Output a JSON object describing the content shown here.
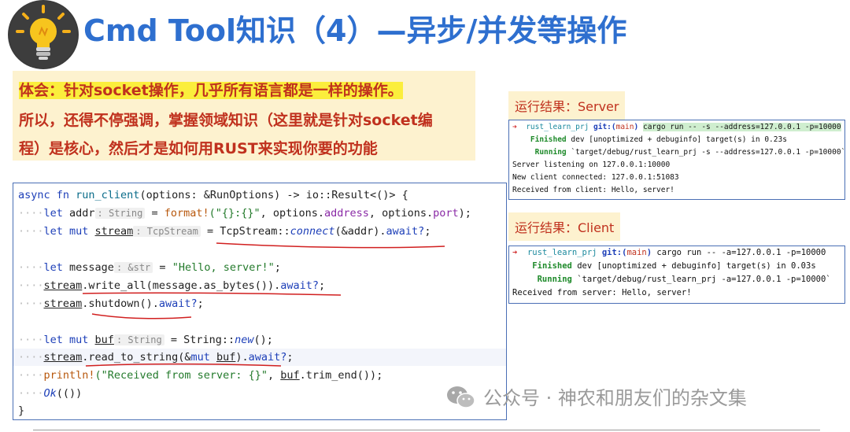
{
  "title": "Cmd Tool知识（4）—异步/并发等操作",
  "note": {
    "line1": "体会：针对socket操作，几乎所有语言都是一样的操作。",
    "line2": "所以，还得不停强调，掌握领域知识（这里就是针对socket编",
    "line3": "程）是核心，然后才是如何用RUST来实现你要的功能"
  },
  "code": {
    "l1": {
      "a": "async fn ",
      "b": "run_client",
      "c": "(options: &RunOptions) -> io::Result<()> {"
    },
    "l2": {
      "a": "let ",
      "b": "addr",
      "hint": ": String",
      "c": " = ",
      "d": "format!",
      "e": "(\"{}:{}\"",
      "f": ", options.",
      "g": "address",
      "h": ", options.",
      "i": "port",
      "j": ");"
    },
    "l3": {
      "a": "let mut ",
      "b": "stream",
      "hint": ": TcpStream",
      "c": " = TcpStream::",
      "d": "connect",
      "e": "(&addr).",
      "f": "await?",
      "g": ";"
    },
    "l5": {
      "a": "let ",
      "b": "message",
      "hint": ": &str",
      "c": " = ",
      "d": "\"Hello, server!\"",
      "e": ";"
    },
    "l6": {
      "a": "stream",
      "b": ".write_all(message.as_bytes()).",
      "c": "await?",
      "d": ";"
    },
    "l7": {
      "a": "stream",
      "b": ".shutdown().",
      "c": "await?",
      "d": ";"
    },
    "l9": {
      "a": "let mut ",
      "b": "buf",
      "hint": ": String",
      "c": " = String::",
      "d": "new",
      "e": "();"
    },
    "l10": {
      "a": "stream",
      "b": ".read_to_string(&",
      "c": "mut ",
      "d": "buf",
      "e": ").",
      "f": "await?",
      "g": ";"
    },
    "l11": {
      "a": "println!",
      "b": "(\"Received from server: {}\"",
      "c": ", ",
      "d": "buf",
      "e": ".trim_end());"
    },
    "l12": {
      "a": "Ok",
      "b": "(())"
    },
    "l13": "}"
  },
  "server": {
    "label": "运行结果：Server",
    "lines": {
      "l1_arrow": "➜",
      "l1_prj": "rust_learn_prj",
      "l1_git": "git:(",
      "l1_branch": "main",
      "l1_git_close": ")",
      "l1_cmd": "cargo run -- -s --address=127.0.0.1 -p=10000",
      "l2_kw": "Finished",
      "l2_rest": "dev [unoptimized + debuginfo] target(s) in 0.23s",
      "l3_kw": "Running",
      "l3_rest": "`target/debug/rust_learn_prj -s --address=127.0.0.1 -p=10000`",
      "l4": "Server listening on 127.0.0.1:10000",
      "l5": "New client connected: 127.0.0.1:51083",
      "l6": "Received from client: Hello, server!"
    }
  },
  "client": {
    "label": "运行结果：Client",
    "lines": {
      "l1_arrow": "➜",
      "l1_prj": "rust_learn_prj",
      "l1_git": "git:(",
      "l1_branch": "main",
      "l1_git_close": ")",
      "l1_cmd": "cargo run -- -a=127.0.0.1 -p=10000",
      "l2_kw": "Finished",
      "l2_rest": "dev [unoptimized + debuginfo] target(s) in 0.03s",
      "l3_kw": "Running",
      "l3_rest": "`target/debug/rust_learn_prj -a=127.0.0.1 -p=10000`",
      "l4": "Received from server: Hello, server!"
    }
  },
  "watermark": "公众号 · 神农和朋友们的杂文集",
  "icons": {
    "logo": "lightbulb-icon",
    "watermark": "wechat-icon"
  },
  "colors": {
    "title": "#2e6fcf",
    "note_bg": "#fdf2cf",
    "note_text": "#c0311e",
    "underline": "#d11f1f",
    "border": "#4a6fb5"
  }
}
